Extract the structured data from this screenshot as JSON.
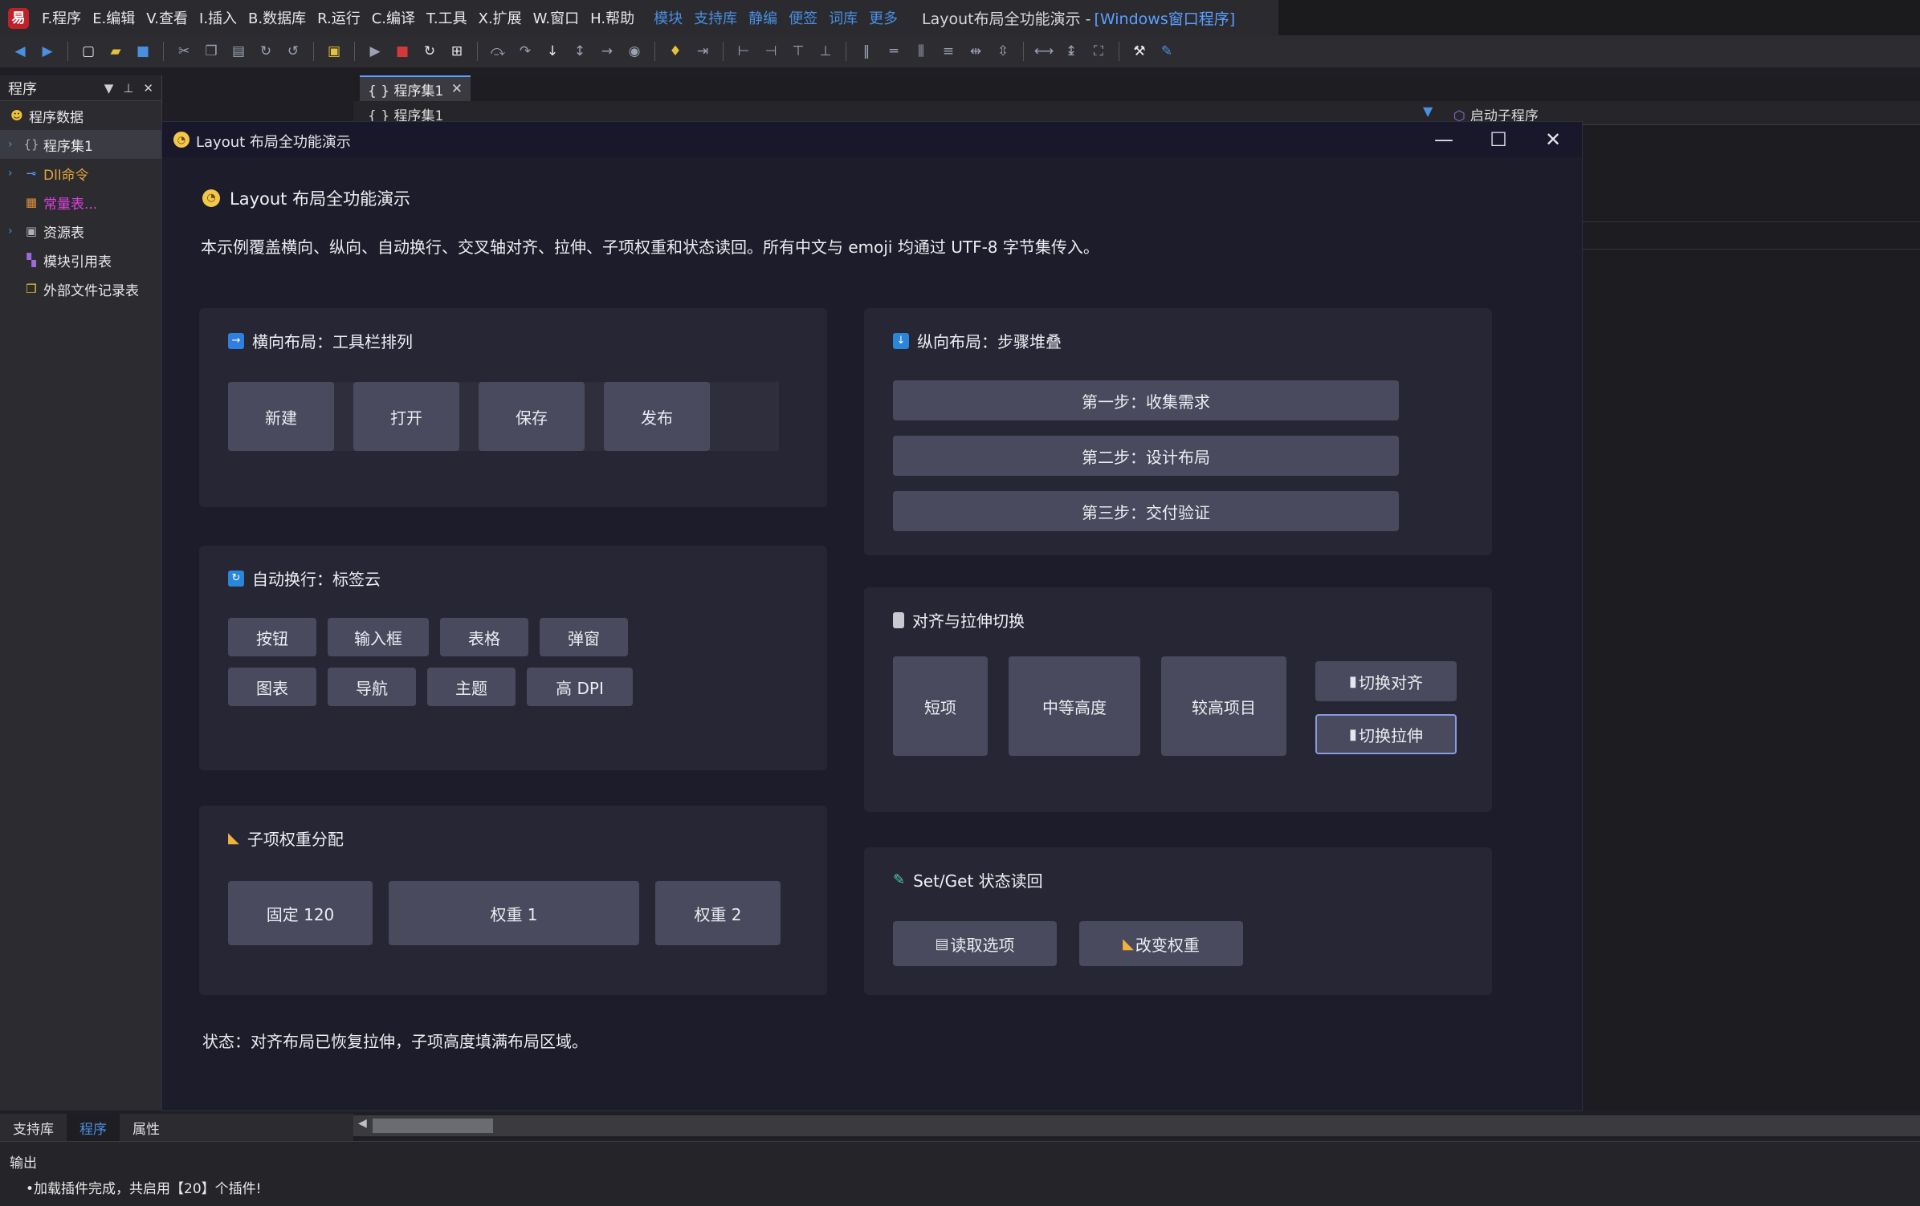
{
  "ide": {
    "menu": [
      "F.程序",
      "E.编辑",
      "V.查看",
      "I.插入",
      "B.数据库",
      "R.运行",
      "C.编译",
      "T.工具",
      "X.扩展",
      "W.窗口",
      "H.帮助"
    ],
    "menu_links": [
      "模块",
      "支持库",
      "静编",
      "便签",
      "词库",
      "更多"
    ],
    "title_main": "Layout布局全功能演示 -",
    "title_sub": "[Windows窗口程序]",
    "left_panel": {
      "header": "程序",
      "items": [
        {
          "label": "程序数据"
        },
        {
          "label": "程序集1"
        },
        {
          "label": "Dll命令"
        },
        {
          "label": "常量表..."
        },
        {
          "label": "资源表"
        },
        {
          "label": "模块引用表"
        },
        {
          "label": "外部文件记录表"
        }
      ]
    },
    "editor_tab": "{ } 程序集1",
    "editor_crumb": "{ } 程序集1",
    "startup_label": "启动子程序",
    "bottom_tabs": [
      "支持库",
      "程序",
      "属性"
    ],
    "output_title": "输出",
    "output_line": "•加载插件完成，共启用【20】个插件!"
  },
  "demo": {
    "window_title": "Layout 布局全功能演示",
    "hero_title": "Layout 布局全功能演示",
    "hero_desc": "本示例覆盖横向、纵向、自动换行、交叉轴对齐、拉伸、子项权重和状态读回。所有中文与 emoji 均通过 UTF-8 字节集传入。",
    "horizontal": {
      "title": "横向布局：工具栏排列",
      "buttons": [
        "新建",
        "打开",
        "保存",
        "发布"
      ]
    },
    "vertical": {
      "title": "纵向布局：步骤堆叠",
      "steps": [
        "第一步：收集需求",
        "第二步：设计布局",
        "第三步：交付验证"
      ]
    },
    "wrap": {
      "title": "自动换行：标签云",
      "tags": [
        "按钮",
        "输入框",
        "表格",
        "弹窗",
        "图表",
        "导航",
        "主题",
        "高 DPI"
      ]
    },
    "align": {
      "title": "对齐与拉伸切换",
      "items": [
        "短项",
        "中等高度",
        "较高项目"
      ],
      "toggle_align": "切换对齐",
      "toggle_stretch": "切换拉伸"
    },
    "weight": {
      "title": "子项权重分配",
      "items": [
        "固定 120",
        "权重 1",
        "权重 2"
      ]
    },
    "setget": {
      "title": "Set/Get 状态读回",
      "read": "读取选项",
      "change": "改变权重"
    },
    "status": "状态：对齐布局已恢复拉伸，子项高度填满布局区域。"
  }
}
